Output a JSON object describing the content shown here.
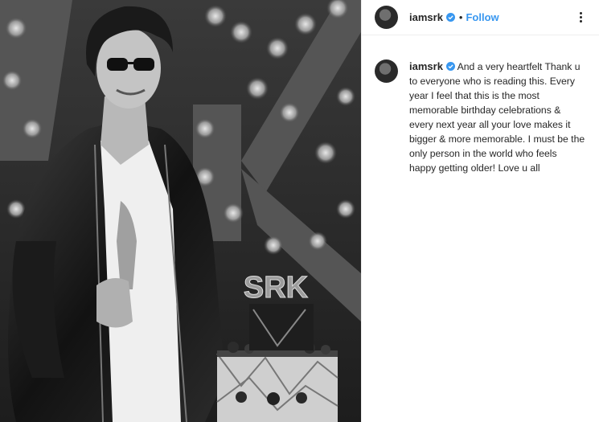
{
  "post": {
    "username": "iamsrk",
    "follow_label": "Follow",
    "separator": "•",
    "caption": "And a very heartfelt Thank u to everyone who is reading this. Every year I feel that this is the most memorable birthday celebrations & every next year all your love makes it bigger & more memorable. I must be the only person in the world who feels happy getting older! Love u all",
    "photo_sign_text": "SRK",
    "cake_topper_text": "SRK"
  },
  "colors": {
    "accent": "#3897f0",
    "text": "#262626",
    "border": "#efefef"
  },
  "icons": {
    "verified": "verified-badge-icon",
    "more": "more-options-icon"
  }
}
